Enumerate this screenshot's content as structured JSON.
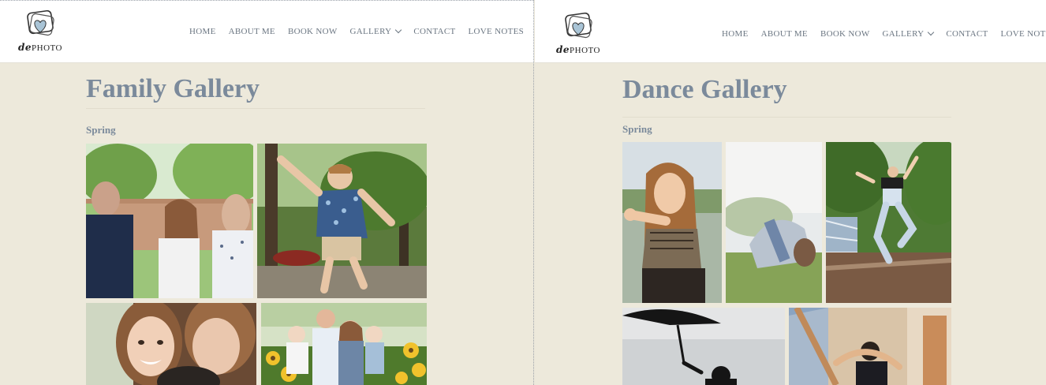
{
  "panels": [
    {
      "brand_logo": "dephoto-camera-heart-logo",
      "brand_text_a": "de",
      "brand_text_b": "PHOTO",
      "nav": {
        "home": "HOME",
        "about": "ABOUT ME",
        "book": "BOOK NOW",
        "gallery": "GALLERY",
        "contact": "CONTACT",
        "love_notes": "LOVE NOTES"
      },
      "title": "Family Gallery",
      "section": "Spring",
      "photos": [
        "family-on-bench-photo",
        "boy-running-photo",
        "girl-smiling-photo",
        "family-sunflowers-photo"
      ]
    },
    {
      "brand_logo": "dephoto-camera-heart-logo",
      "brand_text_a": "de",
      "brand_text_b": "PHOTO",
      "nav": {
        "home": "HOME",
        "about": "ABOUT ME",
        "book": "BOOK NOW",
        "gallery": "GALLERY",
        "contact": "CONTACT",
        "love_notes": "LOVE NOTES"
      },
      "title": "Dance Gallery",
      "section": "Spring",
      "photos": [
        "dancer-pointing-photo",
        "dancer-backbend-photo",
        "dancer-leaping-photo",
        "umbrella-silhouette-photo",
        "dancer-bridge-photo"
      ]
    }
  ],
  "colors": {
    "accent": "#7b8a9b",
    "background": "#ede9db",
    "nav_text": "#6b7682"
  }
}
